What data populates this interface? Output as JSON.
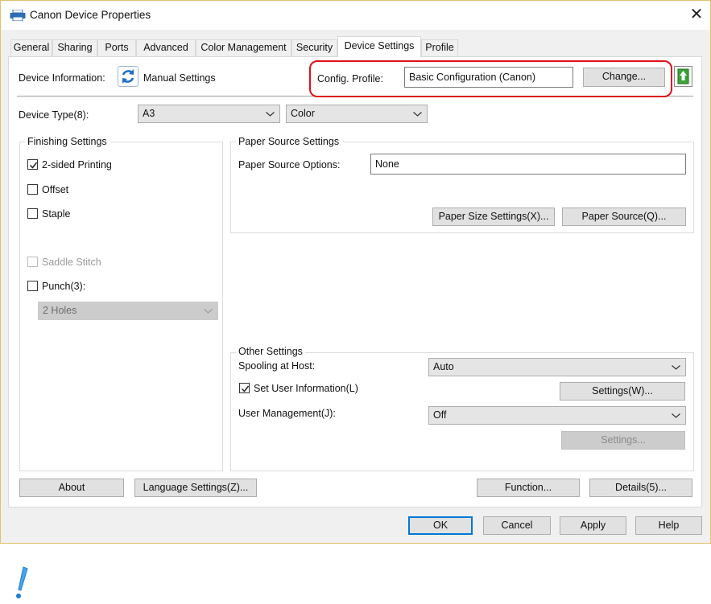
{
  "window": {
    "title": "Canon Device Properties",
    "icon": "printer-icon",
    "close_glyph": "✕"
  },
  "tabs": [
    {
      "label": "General"
    },
    {
      "label": "Sharing"
    },
    {
      "label": "Ports"
    },
    {
      "label": "Advanced"
    },
    {
      "label": "Color Management"
    },
    {
      "label": "Security"
    },
    {
      "label": "Device Settings",
      "active": true
    },
    {
      "label": "Profile"
    }
  ],
  "device_info": {
    "label": "Device Information:",
    "mode_icon": "sync-icon",
    "mode_label": "Manual Settings",
    "config_label": "Config. Profile:",
    "config_value": "Basic Configuration (Canon)",
    "change_button": "Change...",
    "export_icon": "upload-icon"
  },
  "device_type": {
    "label": "Device Type(8):",
    "size_value": "A3",
    "color_value": "Color"
  },
  "finishing": {
    "title": "Finishing Settings",
    "two_sided": {
      "label": "2-sided Printing",
      "checked": true
    },
    "offset": {
      "label": "Offset",
      "checked": false
    },
    "staple": {
      "label": "Staple",
      "checked": false
    },
    "saddle_stitch": {
      "label": "Saddle Stitch",
      "checked": false,
      "disabled": true
    },
    "punch": {
      "label": "Punch(3):",
      "checked": false
    },
    "punch_value": "2 Holes"
  },
  "paper_source": {
    "title": "Paper Source Settings",
    "options_label": "Paper Source Options:",
    "options_value": "None",
    "size_button": "Paper Size Settings(X)...",
    "source_button": "Paper Source(Q)..."
  },
  "other_settings": {
    "title": "Other Settings",
    "spooling_label": "Spooling at Host:",
    "spooling_value": "Auto",
    "user_info": {
      "label": "Set User Information(L)",
      "checked": true
    },
    "settings_w_button": "Settings(W)...",
    "user_mgmt_label": "User Management(J):",
    "user_mgmt_value": "Off",
    "settings_disabled_button": "Settings..."
  },
  "bottom_buttons": {
    "about": "About",
    "language": "Language Settings(Z)...",
    "function": "Function...",
    "details": "Details(5)..."
  },
  "dialog_buttons": {
    "ok": "OK",
    "cancel": "Cancel",
    "apply": "Apply",
    "help": "Help"
  },
  "colors": {
    "highlight": "#e0101b",
    "accent": "#0078d7",
    "note_icon": "#1a7fd4"
  },
  "note_icon": "exclamation-icon"
}
